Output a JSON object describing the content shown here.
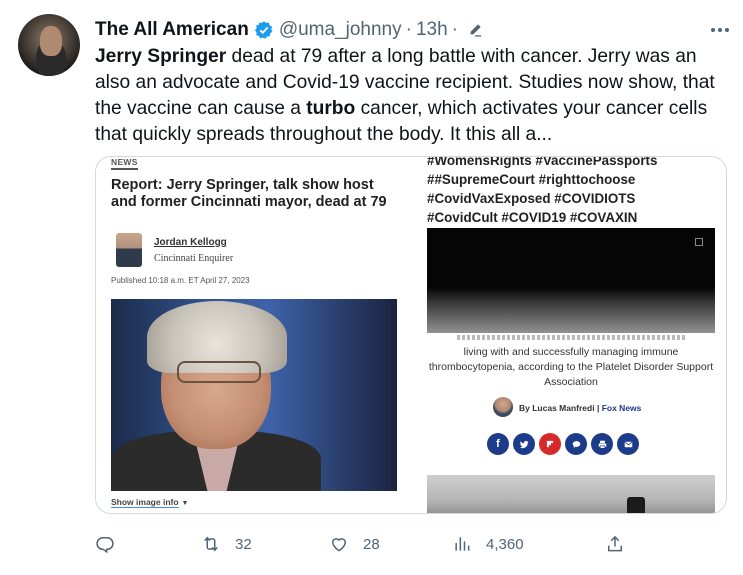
{
  "tweet": {
    "display_name": "The All American",
    "handle": "@uma_johnny",
    "separator": "·",
    "time": "13h",
    "separator2": "·",
    "text_parts": [
      {
        "text": "Jerry Springer",
        "bold": true
      },
      {
        "text": " dead at 79 after a long battle with cancer. Jerry was an also an advocate and Covid-19 vaccine recipient. Studies now show, that the vaccine can cause a ",
        "bold": false
      },
      {
        "text": "turbo",
        "bold": true
      },
      {
        "text": " cancer, which activates your cancer cells that quickly spreads throughout the body. It this all a...",
        "bold": false
      }
    ]
  },
  "media_left": {
    "tag": "NEWS",
    "title": "Report: Jerry Springer, talk show host and former Cincinnati mayor, dead at 79",
    "author": "Jordan Kellogg",
    "org": "Cincinnati Enquirer",
    "published": "Published 10:18 a.m. ET April 27, 2023",
    "show_image_info": "Show image info"
  },
  "media_right": {
    "hashtags_1": "#WomensRights #VaccinePassports",
    "hashtags_2": "##SupremeCourt #righttochoose",
    "hashtags_3": "#CovidVaxExposed #COVIDIOTS",
    "hashtags_4": "#CovidCult #COVID19 #COVAXIN",
    "caption": "living with and successfully managing immune thrombocytopenia, according to the Platelet Disorder Support Association",
    "byline_prefix": "By ",
    "byline_author": "Lucas Manfredi",
    "byline_sep": " | ",
    "byline_brand": "Fox News",
    "share_icons": [
      "facebook-icon",
      "twitter-icon",
      "flipboard-icon",
      "comment-icon",
      "print-icon",
      "email-icon"
    ]
  },
  "actions": {
    "retweets": "32",
    "likes": "28",
    "views": "4,360"
  },
  "colors": {
    "verified": "#1d9bf0",
    "secondary_text": "#536471",
    "fox_blue": "#1d3b8b"
  }
}
